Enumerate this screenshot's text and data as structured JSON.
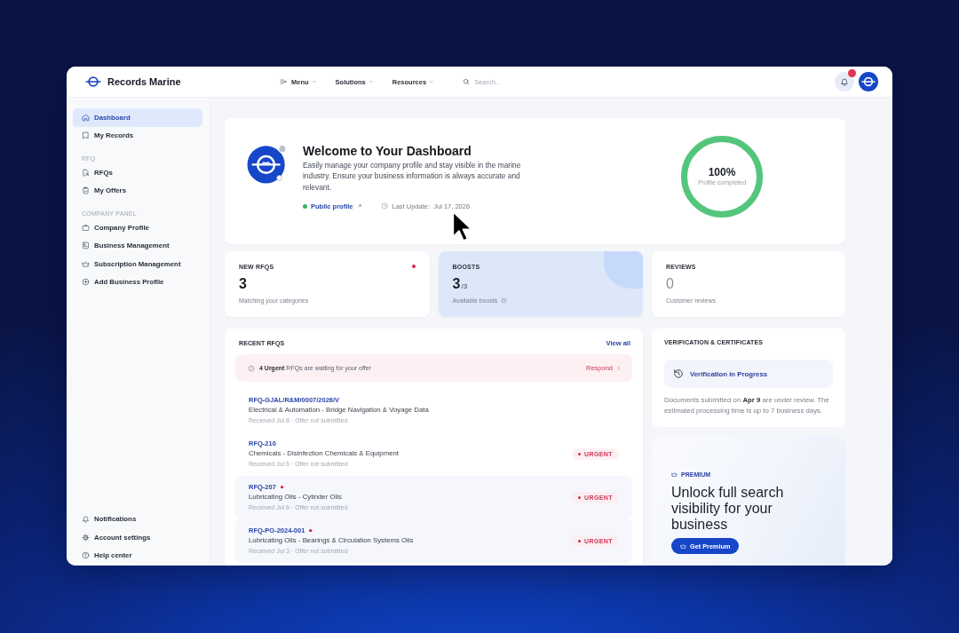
{
  "topbar": {
    "brand": "Records Marine",
    "nav": [
      {
        "label": "Menu",
        "kind": "menu"
      },
      {
        "label": "Solutions",
        "kind": "dropdown"
      },
      {
        "label": "Resources",
        "kind": "dropdown"
      }
    ],
    "search": {
      "placeholder": "Search..."
    },
    "notifications": {
      "unread": true
    }
  },
  "sidebar": {
    "sections": [
      {
        "items": [
          {
            "label": "Dashboard",
            "selected": true
          },
          {
            "label": "My Records",
            "selected": false
          }
        ]
      },
      {
        "title": "RFQ",
        "items": [
          {
            "label": "RFQs",
            "selected": false
          },
          {
            "label": "My Offers",
            "selected": false
          }
        ]
      },
      {
        "title": "COMPANY PANEL",
        "items": [
          {
            "label": "Company Profile",
            "selected": false
          },
          {
            "label": "Business Management",
            "selected": false
          },
          {
            "label": "Subscription Management",
            "selected": false
          },
          {
            "label": "Add Business Profile",
            "selected": false
          }
        ]
      }
    ],
    "footer": [
      {
        "label": "Notifications",
        "selected": false
      },
      {
        "label": "Account settings",
        "selected": false
      },
      {
        "label": "Help center",
        "selected": false
      }
    ]
  },
  "welcome": {
    "title": "Welcome to Your Dashboard",
    "description": "Easily manage your company profile and stay visible in the marine industry. Ensure your business information is always accurate and relevant.",
    "public_link": "Public profile",
    "last_update": "Last Update:  Jul 17, 2026",
    "progress": {
      "level": 1,
      "value": "100%",
      "caption": "Profile completed"
    }
  },
  "stats": [
    {
      "label": "NEW RFQS",
      "value": "3",
      "caption": "Matching your categories",
      "unread": true,
      "highlighted": false,
      "muted": false,
      "info": false
    },
    {
      "label": "BOOSTS",
      "value": "3",
      "suffix": "/3",
      "caption": "Available boosts",
      "unread": false,
      "highlighted": true,
      "muted": false,
      "info": true
    },
    {
      "label": "REVIEWS",
      "value": "0",
      "caption": "Customer reviews",
      "unread": false,
      "highlighted": false,
      "muted": true,
      "info": false
    }
  ],
  "recent_rfqs": {
    "title": "RECENT RFQS",
    "view_all": "View all",
    "alert": {
      "text": "**4 Urgent** RFQs are waiting for your offer",
      "action": "Respond"
    },
    "rows": [
      {
        "id": "RFQ-GJAL/R&M/0007/2026/V",
        "description": "Electrical & Automation - Bridge Navigation & Voyage Data",
        "meta": "Received Jul 8 · Offer not submitted",
        "unread": false
      },
      {
        "id": "RFQ-210",
        "description": "Chemicals - Disinfection Chemicals & Equipment",
        "meta": "Received Jul 6 · Offer not submitted",
        "unread": false,
        "tag": "URGENT"
      },
      {
        "id": "RFQ-207",
        "description": "Lubricating Oils - Cylinder Oils",
        "meta": "Received Jul 6 · Offer not submitted",
        "unread": true,
        "tag": "URGENT"
      },
      {
        "id": "RFQ-PO-2024-001",
        "description": "Lubricating Oils - Bearings & Circulation Systems Oils",
        "meta": "Received Jul 3 · Offer not submitted",
        "unread": true,
        "tag": "URGENT"
      }
    ]
  },
  "verification": {
    "title": "VERIFICATION & CERTIFICATES",
    "status": "Verification in Progress",
    "note": "Documents submitted on **Apr 9** are under review. The estimated processing time is up to 7 business days."
  },
  "premium": {
    "tag": "PREMIUM",
    "heading": "Unlock full search visibility for your business",
    "button": "Get Premium"
  }
}
